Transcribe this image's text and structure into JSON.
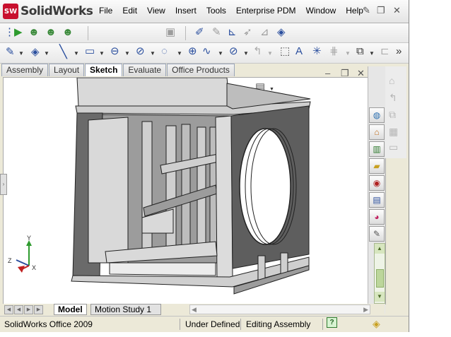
{
  "app": {
    "logo_badge": "SW",
    "logo_text": "SolidWorks",
    "menu": [
      "File",
      "Edit",
      "View",
      "Insert",
      "Tools",
      "Enterprise PDM",
      "Window",
      "Help"
    ]
  },
  "tabs": [
    "Assembly",
    "Layout",
    "Sketch",
    "Evaluate",
    "Office Products"
  ],
  "active_tab": "Sketch",
  "bottom_tabs": [
    "Model",
    "Motion Study 1"
  ],
  "status": {
    "product": "SolidWorks Office 2009",
    "state": "Under Defined",
    "mode": "Editing Assembly",
    "help": "?"
  },
  "triad": {
    "x": "X",
    "y": "Y",
    "z": "Z"
  },
  "colors": {
    "accent": "#2b4f9e",
    "model_face": "#d3d3d3",
    "model_shadow": "#6a6a6a"
  }
}
